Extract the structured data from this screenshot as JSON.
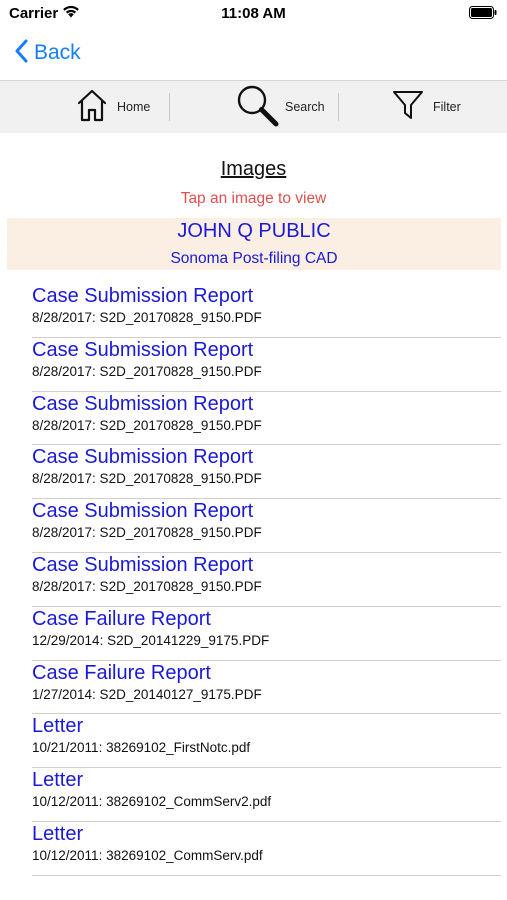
{
  "status_bar": {
    "carrier": "Carrier",
    "time": "11:08 AM"
  },
  "nav": {
    "back_label": "Back"
  },
  "toolbar": {
    "home_label": "Home",
    "search_label": "Search",
    "filter_label": "Filter"
  },
  "section": {
    "title": "Images",
    "hint": "Tap an image to view"
  },
  "header": {
    "name": "JOHN Q PUBLIC",
    "subtitle": "Sonoma Post-filing CAD"
  },
  "items": [
    {
      "title": "Case Submission Report",
      "detail": "8/28/2017: S2D_20170828_9150.PDF"
    },
    {
      "title": "Case Submission Report",
      "detail": "8/28/2017: S2D_20170828_9150.PDF"
    },
    {
      "title": "Case Submission Report",
      "detail": "8/28/2017: S2D_20170828_9150.PDF"
    },
    {
      "title": "Case Submission Report",
      "detail": "8/28/2017: S2D_20170828_9150.PDF"
    },
    {
      "title": "Case Submission Report",
      "detail": "8/28/2017: S2D_20170828_9150.PDF"
    },
    {
      "title": "Case Submission Report",
      "detail": "8/28/2017: S2D_20170828_9150.PDF"
    },
    {
      "title": "Case Failure Report",
      "detail": "12/29/2014: S2D_20141229_9175.PDF"
    },
    {
      "title": "Case Failure Report",
      "detail": "1/27/2014: S2D_20140127_9175.PDF"
    },
    {
      "title": "Letter",
      "detail": "10/21/2011: 38269102_FirstNotc.pdf"
    },
    {
      "title": "Letter",
      "detail": "10/12/2011: 38269102_CommServ2.pdf"
    },
    {
      "title": "Letter",
      "detail": "10/12/2011: 38269102_CommServ.pdf"
    }
  ],
  "colors": {
    "accent": "#147efb",
    "link": "#1a1ad6",
    "hint": "#e05050",
    "header_bg": "#fbeee2",
    "toolbar_bg": "#f1f1f1"
  }
}
